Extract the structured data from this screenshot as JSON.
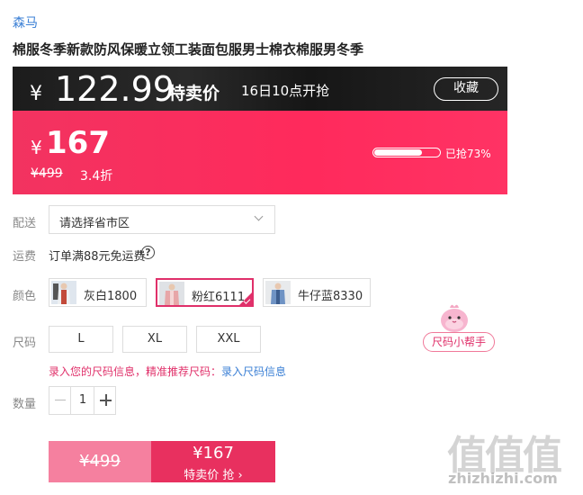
{
  "brand": "森马",
  "title": "棉服冬季新款防风保暖立领工装面包服男士棉衣棉服男冬季",
  "promo_top": {
    "currency": "¥",
    "price": "122.99",
    "tag": "特卖价",
    "start_time": "16日10点开抢",
    "favorite_label": "收藏"
  },
  "promo_main": {
    "currency": "¥",
    "price": "167",
    "original_price": "¥499",
    "discount": "3.4折",
    "sold_progress": 0.73,
    "sold_label": "已抢73%"
  },
  "labels": {
    "delivery": "配送",
    "shipping": "运费",
    "color": "颜色",
    "size": "尺码",
    "quantity": "数量"
  },
  "delivery": {
    "placeholder": "请选择省市区"
  },
  "shipping": {
    "text": "订单满88元免运费",
    "help_icon": "?"
  },
  "colors": [
    {
      "label": "灰白1800",
      "selected": false
    },
    {
      "label": "粉红6111",
      "selected": true
    },
    {
      "label": "牛仔蓝8330",
      "selected": false
    }
  ],
  "sizes": [
    "L",
    "XL",
    "XXL"
  ],
  "size_helper_label": "尺码小帮手",
  "size_tip": {
    "text": "录入您的尺码信息，精准推荐尺码：",
    "link": "录入尺码信息"
  },
  "quantity": {
    "value": "1"
  },
  "buy": {
    "original_price": "¥499",
    "price": "¥167",
    "action": "特卖价 抢 ›"
  },
  "watermark": {
    "logo": "值值值",
    "url": "zhizhizhi.com"
  },
  "theme": {
    "accent": "#e8305f",
    "link": "#3a7fd5",
    "dark": "#1c1c1c"
  }
}
